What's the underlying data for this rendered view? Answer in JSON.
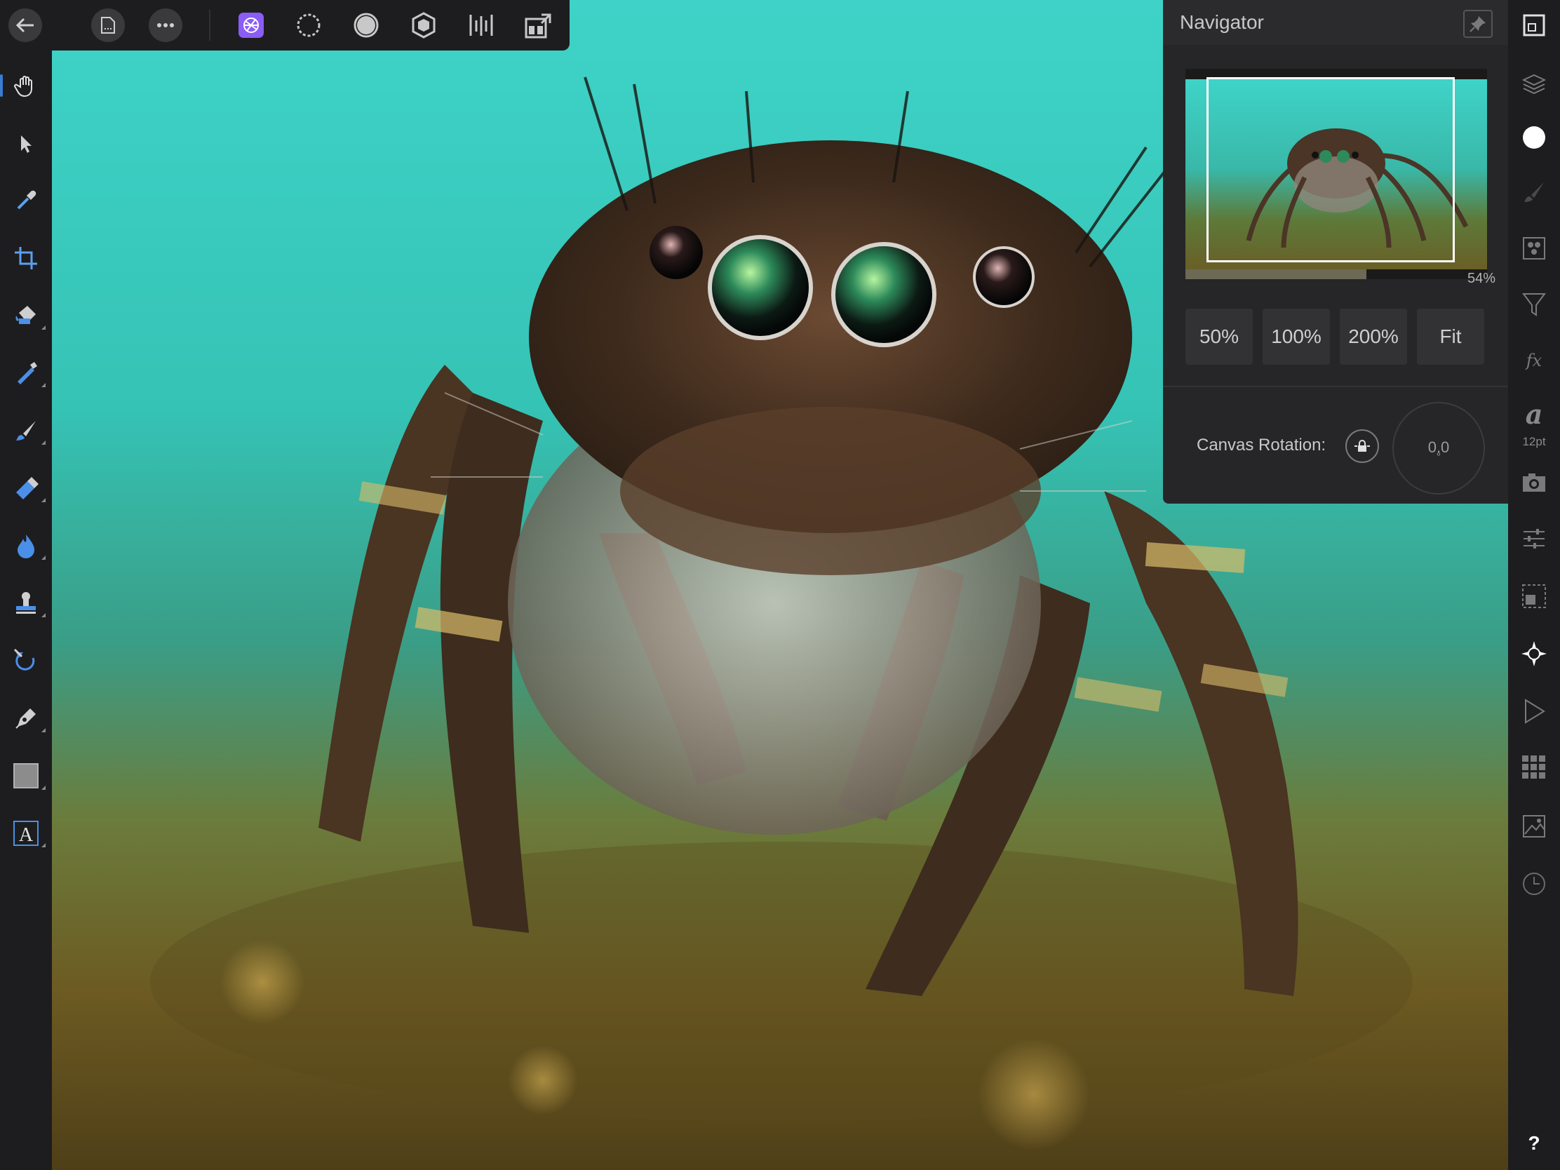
{
  "navigator": {
    "title": "Navigator",
    "zoom_percent_label": "54%",
    "zoom_fraction": 0.6,
    "zoom_presets": [
      "50%",
      "100%",
      "200%",
      "Fit"
    ],
    "canvas_rotation_label": "Canvas Rotation:",
    "canvas_rotation_value": "0.0",
    "canvas_rotation_unit": "°"
  },
  "studio": {
    "text_tool_size": "12pt",
    "help_label": "?"
  },
  "left_tools": [
    "hand-tool-icon",
    "move-tool-icon",
    "color-picker-icon",
    "crop-tool-icon",
    "flood-fill-icon",
    "selection-brush-icon",
    "paint-brush-icon",
    "erase-brush-icon",
    "dodge-burn-icon",
    "clone-stamp-icon",
    "undo-brush-icon",
    "pen-tool-icon",
    "rectangle-tool-icon",
    "text-tool-icon"
  ],
  "top_tools": [
    "back-icon",
    "document-icon",
    "more-icon",
    "photo-persona-icon",
    "liquify-persona-icon",
    "develop-persona-icon",
    "tone-mapping-persona-icon",
    "batch-persona-icon",
    "export-persona-icon"
  ],
  "right_tools": [
    "navigator-icon",
    "layers-icon",
    "color-icon",
    "brushes-icon",
    "channels-icon",
    "adjustments-icon",
    "fx-icon",
    "text-styles-icon",
    "snapshots-icon",
    "adjustment-layers-icon",
    "transform-icon",
    "navigator-compass-icon",
    "macros-icon",
    "swatches-icon",
    "stock-icon",
    "history-icon",
    "help-icon"
  ],
  "colors": {
    "panel_bg": "#262628",
    "toolbar_bg": "#1d1d1f",
    "accent_blue": "#3a7bd5",
    "persona_purple": "#8b5cf6"
  }
}
